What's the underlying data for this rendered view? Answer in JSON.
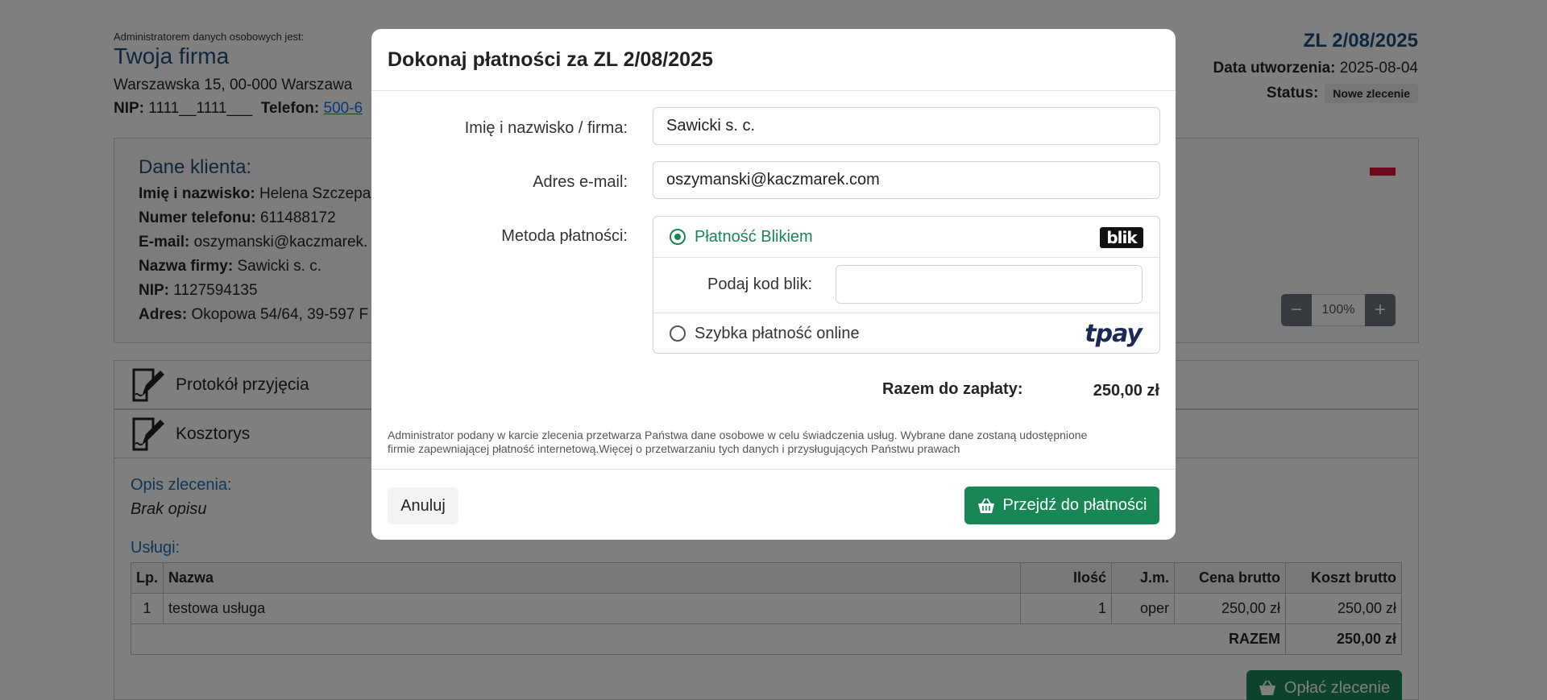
{
  "company": {
    "admin_note": "Administratorem danych osobowych jest:",
    "name": "Twoja firma",
    "address": "Warszawska 15, 00-000 Warszawa",
    "nip_label": "NIP:",
    "nip_value": "1111__1111___",
    "phone_label": "Telefon:",
    "phone_value": "500-6"
  },
  "order": {
    "number": "ZL 2/08/2025",
    "created_label": "Data utworzenia:",
    "created_value": "2025-08-04",
    "status_label": "Status:",
    "status_value": "Nowe zlecenie"
  },
  "client": {
    "title": "Dane klienta:",
    "rows": [
      {
        "label": "Imię i nazwisko:",
        "value": "Helena Szczepa"
      },
      {
        "label": "Numer telefonu:",
        "value": "611488172"
      },
      {
        "label": "E-mail:",
        "value": "oszymanski@kaczmarek."
      },
      {
        "label": "Nazwa firmy:",
        "value": "Sawicki s. c."
      },
      {
        "label": "NIP:",
        "value": "1127594135"
      },
      {
        "label": "Adres:",
        "value": "Okopowa 54/64, 39-597 F"
      }
    ],
    "zoom_value": "100%",
    "zoom_minus": "−",
    "zoom_plus": "+"
  },
  "sections": {
    "protocol": "Protokół przyjęcia",
    "estimate": "Kosztorys"
  },
  "estimate": {
    "desc_label": "Opis zlecenia:",
    "desc_value": "Brak opisu",
    "services_label": "Usługi:",
    "columns": [
      "Lp.",
      "Nazwa",
      "Ilość",
      "J.m.",
      "Cena brutto",
      "Koszt brutto"
    ],
    "rows": [
      {
        "lp": "1",
        "name": "testowa usługa",
        "qty": "1",
        "unit": "oper",
        "price": "250,00 zł",
        "cost": "250,00 zł"
      }
    ],
    "total_label": "RAZEM",
    "total_value": "250,00 zł",
    "pay_button": "Opłać zlecenie"
  },
  "modal": {
    "title": "Dokonaj płatności za ZL 2/08/2025",
    "name_label": "Imię i nazwisko / firma:",
    "name_value": "Sawicki s. c.",
    "email_label": "Adres e-mail:",
    "email_value": "oszymanski@kaczmarek.com",
    "method_label": "Metoda płatności:",
    "method_blik": "Płatność Blikiem",
    "blik_logo": "blik",
    "blik_code_label": "Podaj kod blik:",
    "blik_code_value": "",
    "method_online": "Szybka płatność online",
    "tpay_logo": "tpay",
    "sum_label": "Razem do zapłaty:",
    "sum_value": "250,00 zł",
    "gdpr_line1": "Administrator podany w karcie zlecenia przetwarza Państwa dane osobowe w celu świadczenia usług. Wybrane dane zostaną udostępnione",
    "gdpr_line2": "firmie zapewniającej płatność internetową.Więcej o przetwarzaniu tych danych i przysługujących Państwu prawach",
    "cancel": "Anuluj",
    "proceed": "Przejdź do płatności"
  },
  "colors": {
    "primary_blue": "#1f4e79",
    "success_green": "#198754",
    "flag_red": "#dc143c"
  }
}
